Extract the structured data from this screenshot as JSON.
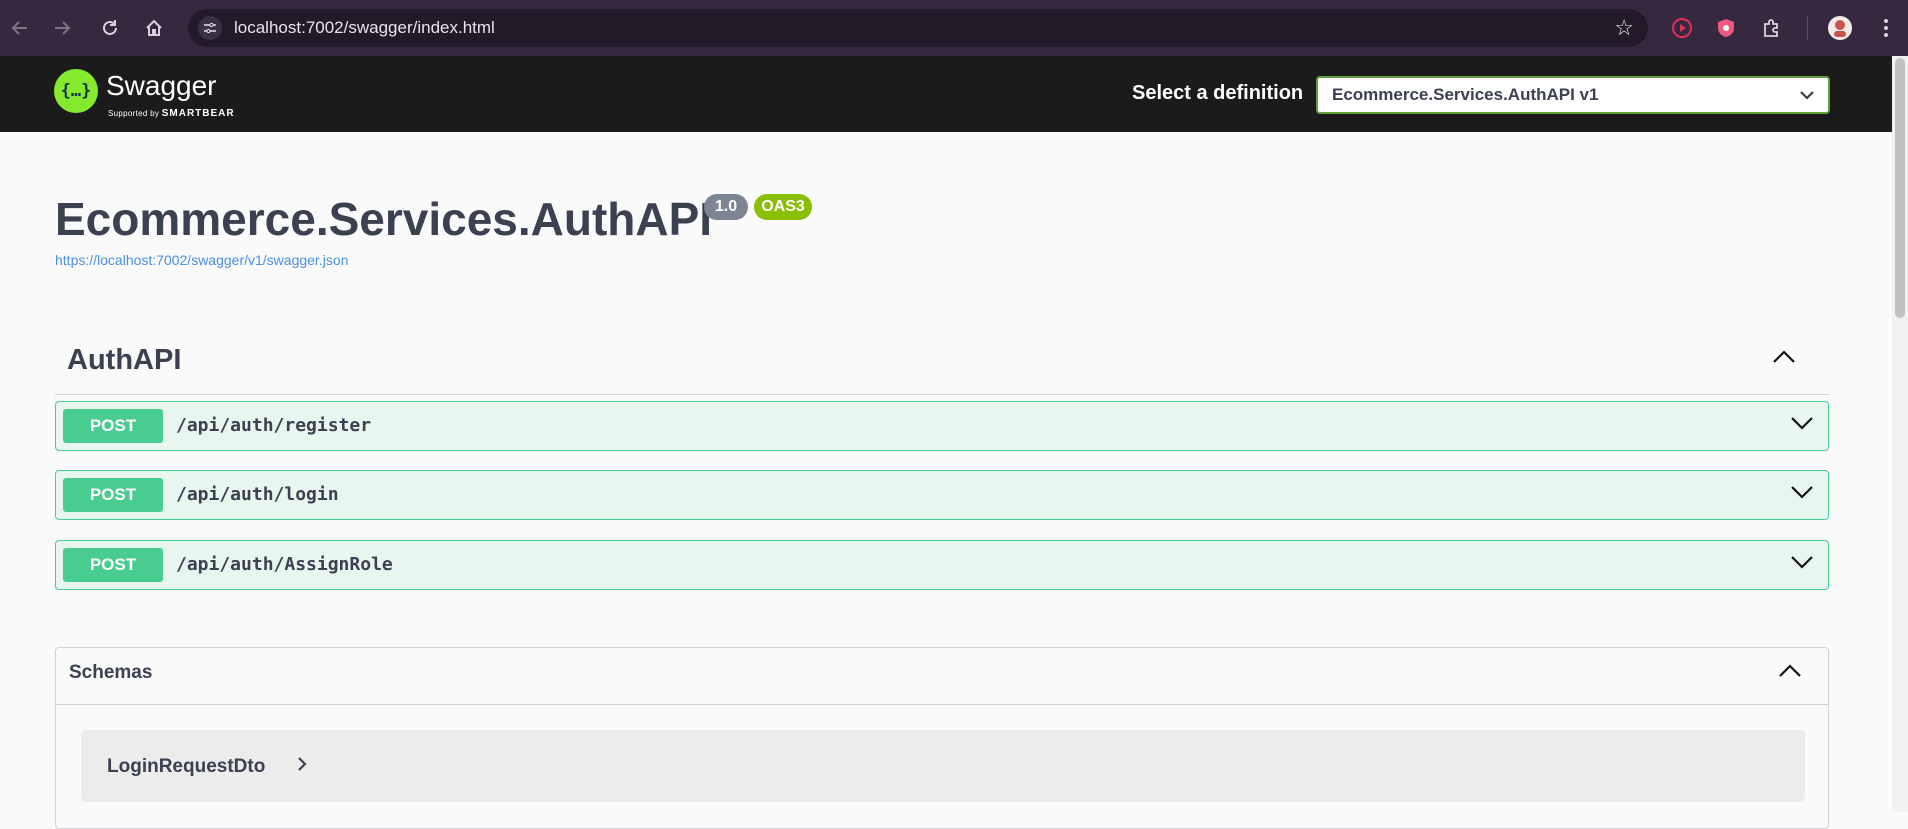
{
  "browser": {
    "url": "localhost:7002/swagger/index.html"
  },
  "topbar": {
    "logo_text": "Swagger",
    "logo_sub_prefix": "Supported by",
    "logo_sub_brand": "SMARTBEAR",
    "definition_label": "Select a definition",
    "definition_selected": "Ecommerce.Services.AuthAPI v1"
  },
  "info": {
    "title": "Ecommerce.Services.AuthAPI",
    "version": "1.0",
    "oas": "OAS3",
    "spec_url": "https://localhost:7002/swagger/v1/swagger.json"
  },
  "tag": {
    "name": "AuthAPI",
    "operations": [
      {
        "method": "POST",
        "path": "/api/auth/register"
      },
      {
        "method": "POST",
        "path": "/api/auth/login"
      },
      {
        "method": "POST",
        "path": "/api/auth/AssignRole"
      }
    ]
  },
  "schemas": {
    "title": "Schemas",
    "models": [
      "LoginRequestDto"
    ]
  },
  "colors": {
    "post": "#49cc90",
    "post_bg": "#e8f6f0",
    "swagger_green": "#85ea2d",
    "topbar_bg": "#1b1b1b"
  }
}
